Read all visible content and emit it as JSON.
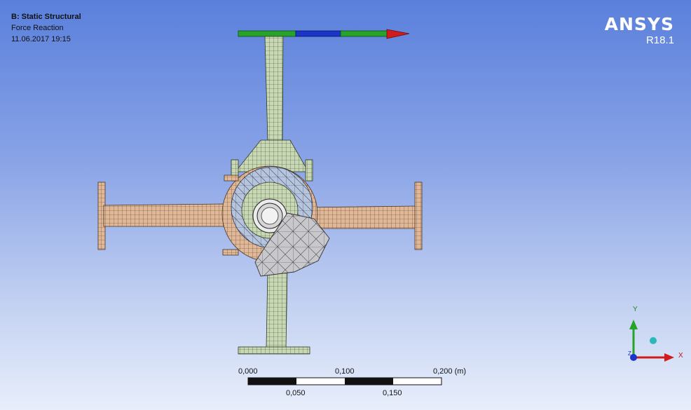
{
  "analysis": {
    "title": "B: Static Structural",
    "result": "Force Reaction",
    "timestamp": "11.06.2017 19:15"
  },
  "brand": {
    "name": "ANSYS",
    "version": "R18.1"
  },
  "scale_bar": {
    "top_labels": [
      "0,000",
      "0,100",
      "0,200 (m)"
    ],
    "bottom_labels": [
      "0,050",
      "0,150"
    ]
  },
  "triad": {
    "x_label": "X",
    "y_label": "Y",
    "z_label": "Z"
  },
  "colors": {
    "background_top": "#5a80dc",
    "background_bottom": "#e8eefb",
    "pipe_green": "#c9d8b4",
    "pipe_tan": "#e0b898",
    "rotor_blue": "#b6c4de",
    "cam_gray": "#c8c8cc",
    "force_vector_red": "#d01c1c",
    "force_vector_green": "#27a32a",
    "force_vector_blue": "#1a35c8"
  }
}
